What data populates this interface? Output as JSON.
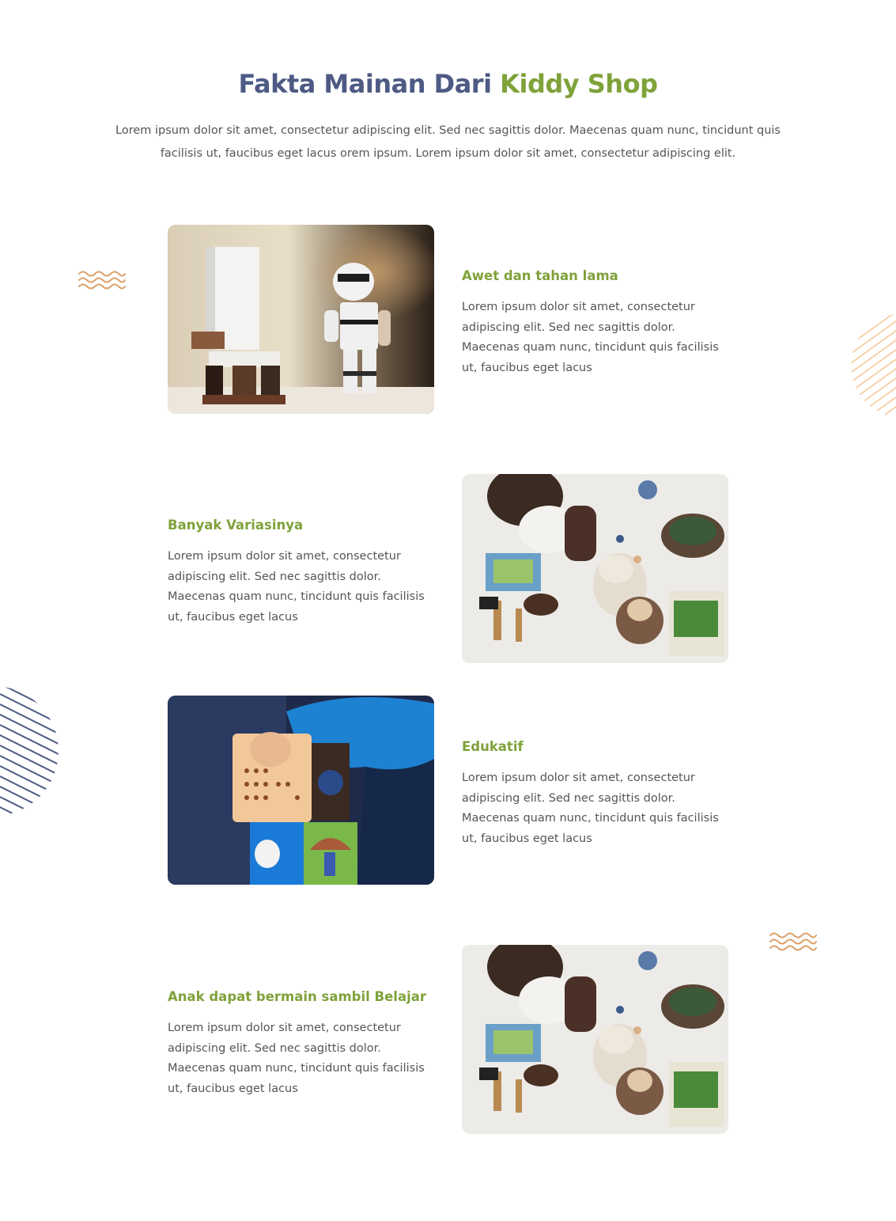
{
  "section": {
    "title_main": "Fakta Mainan Dari",
    "title_brand": "Kiddy Shop",
    "intro": "Lorem ipsum dolor sit amet, consectetur adipiscing elit. Sed nec sagittis dolor. Maecenas quam nunc, tincidunt quis facilisis ut, faucibus eget lacus orem ipsum. Lorem ipsum dolor sit amet, consectetur adipiscing elit."
  },
  "features": [
    {
      "title": "Awet dan tahan lama",
      "text": "Lorem ipsum dolor sit amet, consectetur adipiscing elit. Sed nec sagittis dolor. Maecenas quam nunc, tincidunt quis facilisis ut, faucibus eget lacus",
      "image": "stormtrooper-toy-photo"
    },
    {
      "title": "Banyak Variasinya",
      "text": "Lorem ipsum dolor sit amet, consectetur adipiscing elit. Sed nec sagittis dolor. Maecenas quam nunc, tincidunt quis facilisis ut, faucibus eget lacus",
      "image": "child-playing-toys-photo"
    },
    {
      "title": "Edukatif",
      "text": "Lorem ipsum dolor sit amet, consectetur adipiscing elit. Sed nec sagittis dolor. Maecenas quam nunc, tincidunt quis facilisis ut, faucibus eget lacus",
      "image": "toy-blocks-photo"
    },
    {
      "title": "Anak dapat bermain sambil Belajar",
      "text": "Lorem ipsum dolor sit amet, consectetur adipiscing elit. Sed nec sagittis dolor. Maecenas quam nunc, tincidunt quis facilisis ut, faucibus eget lacus",
      "image": "child-playing-toys-photo"
    }
  ],
  "colors": {
    "title_main": "#4d5a84",
    "brand": "#7fa23a",
    "body_text": "#555555",
    "wave_accent": "#dba06a",
    "stripe_peach": "#f6c99a",
    "stripe_navy": "#4d5a84"
  }
}
